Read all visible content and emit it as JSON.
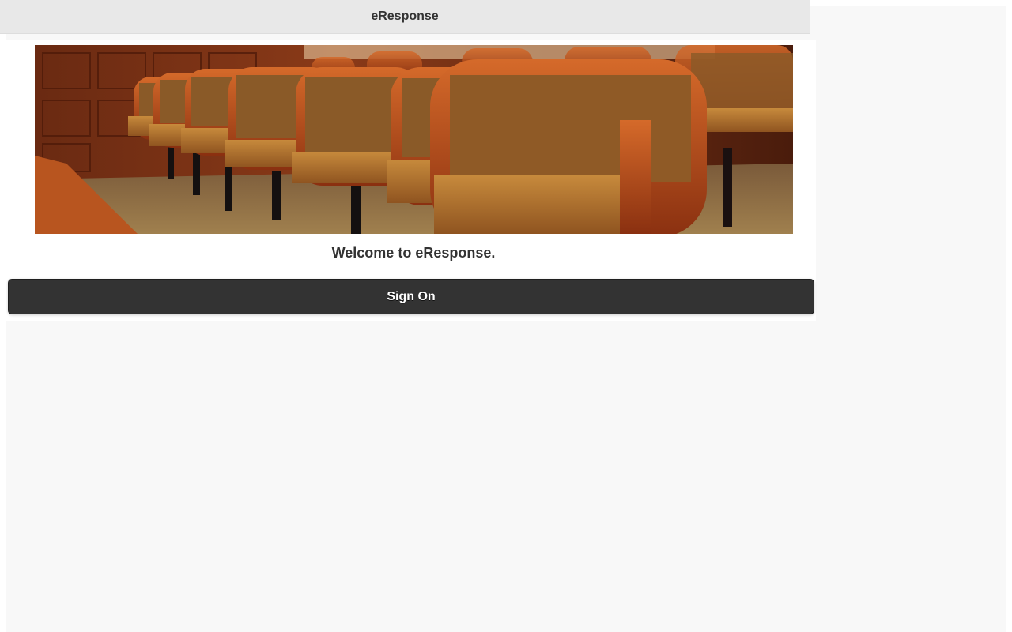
{
  "header": {
    "title": "eResponse"
  },
  "main": {
    "welcome_text": "Welcome to eResponse.",
    "sign_on_label": "Sign On"
  },
  "colors": {
    "header_bg": "#e8e8e8",
    "button_bg": "#333333",
    "page_bg": "#f8f8f8"
  }
}
